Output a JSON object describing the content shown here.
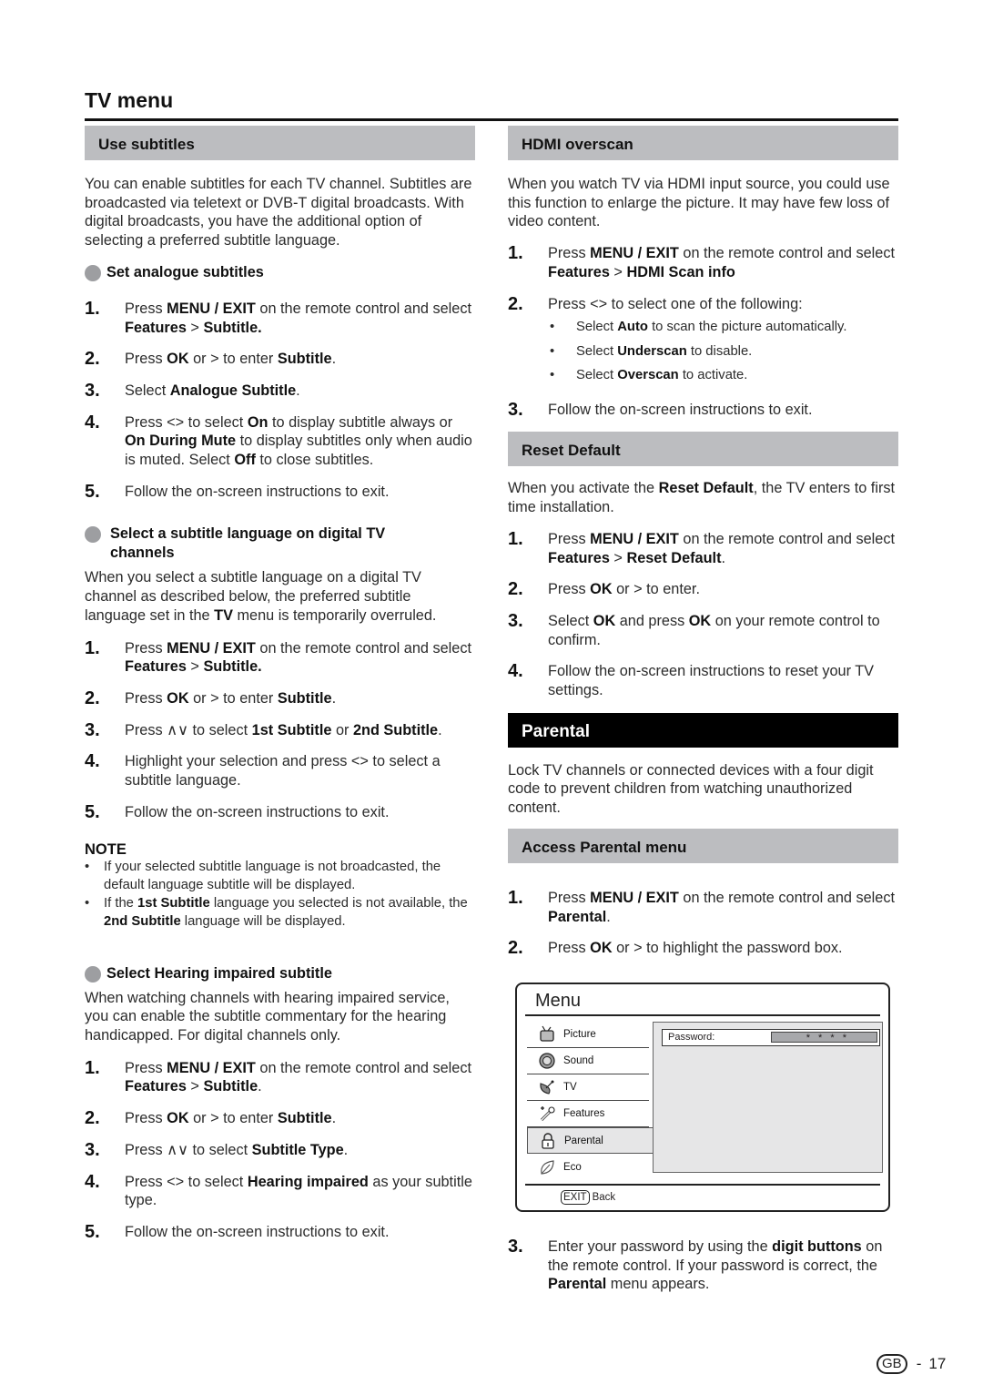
{
  "page": {
    "title": "TV menu",
    "footer": {
      "region_badge": "GB",
      "separator": "-",
      "page_number": "17"
    }
  },
  "left": {
    "use_subtitles": {
      "heading": "Use subtitles",
      "intro": "You can enable subtitles for each TV channel. Subtitles are broadcasted via teletext or DVB-T digital broadcasts. With digital broadcasts, you have the additional option of selecting a preferred subtitle language."
    },
    "analogue": {
      "heading": "Set analogue subtitles",
      "steps": [
        {
          "num": "1.",
          "html": "Press <b>MENU / EXIT</b> on the remote control and select <b>Features</b> &gt; <b>Subtitle.</b>"
        },
        {
          "num": "2.",
          "html": "Press <b>OK</b> or &gt; to enter <b>Subtitle</b>."
        },
        {
          "num": "3.",
          "html": "Select <b>Analogue Subtitle</b>."
        },
        {
          "num": "4.",
          "html": "Press &lt;&gt; to select <b>On</b> to display subtitle always or <b>On During Mute</b> to display subtitles only when audio is muted. Select <b>Off</b> to close subtitles."
        },
        {
          "num": "5.",
          "html": "Follow the on-screen instructions to exit."
        }
      ]
    },
    "digital": {
      "heading": "Select a subtitle language on digital TV channels",
      "intro_html": "When you select a subtitle language on a digital TV channel as described below, the preferred subtitle language set in the <b>TV</b> menu is temporarily overruled.",
      "steps": [
        {
          "num": "1.",
          "html": "Press <b>MENU / EXIT</b> on the remote control and select <b>Features</b> &gt; <b>Subtitle.</b>"
        },
        {
          "num": "2.",
          "html": "Press <b>OK</b> or &gt; to enter <b>Subtitle</b>."
        },
        {
          "num": "3.",
          "html": "Press ∧∨ to select <b>1st Subtitle</b> or <b>2nd Subtitle</b>."
        },
        {
          "num": "4.",
          "html": "Highlight your selection and press &lt;&gt; to select a subtitle language."
        },
        {
          "num": "5.",
          "html": "Follow the on-screen instructions to exit."
        }
      ]
    },
    "note": {
      "title": "NOTE",
      "items": [
        {
          "html": "If your selected subtitle language is not broadcasted, the default language subtitle will be displayed."
        },
        {
          "html": "If the <b>1st Subtitle</b> language you selected is not available, the <b>2nd Subtitle</b> language will be displayed."
        }
      ]
    },
    "hearing": {
      "heading": "Select Hearing impaired subtitle",
      "intro": "When watching channels with hearing impaired service, you can enable the subtitle commentary for the hearing handicapped. For digital channels only.",
      "steps": [
        {
          "num": "1.",
          "html": "Press <b>MENU / EXIT</b> on the remote control and select <b>Features</b> &gt; <b>Subtitle</b>."
        },
        {
          "num": "2.",
          "html": "Press <b>OK</b> or &gt; to enter <b>Subtitle</b>."
        },
        {
          "num": "3.",
          "html": "Press ∧∨ to select <b>Subtitle Type</b>."
        },
        {
          "num": "4.",
          "html": "Press &lt;&gt; to select <b>Hearing impaired</b> as your subtitle type."
        },
        {
          "num": "5.",
          "html": "Follow the on-screen instructions to exit."
        }
      ]
    }
  },
  "right": {
    "hdmi": {
      "heading": "HDMI overscan",
      "intro": "When you watch TV via HDMI input source, you could use this function to enlarge the picture. It may have few loss of video content.",
      "steps": [
        {
          "num": "1.",
          "html": "Press <b>MENU / EXIT</b> on the remote control and select <b>Features</b> &gt; <b>HDMI Scan info</b>"
        },
        {
          "num": "2.",
          "html": "Press &lt;&gt; to select one of the following:"
        },
        {
          "num": "3.",
          "html": "Follow the on-screen instructions to exit."
        }
      ],
      "options": [
        {
          "html": "Select <b>Auto</b> to scan the picture automatically."
        },
        {
          "html": "Select <b>Underscan</b> to disable."
        },
        {
          "html": "Select <b>Overscan</b> to activate."
        }
      ]
    },
    "reset": {
      "heading": "Reset Default",
      "intro_html": "When you activate the <b>Reset Default</b>, the TV enters to first time installation.",
      "steps": [
        {
          "num": "1.",
          "html": "Press <b>MENU / EXIT</b> on the remote control and select <b>Features</b> &gt; <b>Reset Default</b>."
        },
        {
          "num": "2.",
          "html": "Press <b>OK</b> or &gt; to enter."
        },
        {
          "num": "3.",
          "html": "Select <b>OK</b> and press <b>OK</b> on your remote control to confirm."
        },
        {
          "num": "4.",
          "html": "Follow the on-screen instructions to reset your TV settings."
        }
      ]
    },
    "parental": {
      "heading": "Parental",
      "intro": "Lock TV channels or connected devices with a four digit code to prevent children from watching unauthorized content."
    },
    "access": {
      "heading": "Access Parental menu",
      "steps": [
        {
          "num": "1.",
          "html": "Press <b>MENU / EXIT</b> on the remote control and select <b>Parental</b>."
        },
        {
          "num": "2.",
          "html": "Press <b>OK</b> or &gt; to highlight the password box."
        }
      ],
      "steps_after": [
        {
          "num": "3.",
          "html": "Enter your password by using the <b>digit buttons</b> on the remote control. If your password is correct, the <b>Parental</b> menu appears."
        }
      ]
    }
  },
  "tv_menu": {
    "title": "Menu",
    "items": [
      {
        "label": "Picture",
        "icon": "tv-icon"
      },
      {
        "label": "Sound",
        "icon": "speaker-icon"
      },
      {
        "label": "TV",
        "icon": "satellite-dish-icon"
      },
      {
        "label": "Features",
        "icon": "tools-icon"
      },
      {
        "label": "Parental",
        "icon": "lock-icon",
        "selected": true
      },
      {
        "label": "Eco",
        "icon": "leaf-icon"
      }
    ],
    "password_label": "Password:",
    "password_value": "* * * *",
    "exit_key": "EXIT",
    "back_label": "Back"
  },
  "colors": {
    "section_header_bg": "#bcbdc0",
    "section_header_dark_bg": "#000000",
    "bullet_dot": "#9d9ea1",
    "menu_panel_bg": "#e6e6e7",
    "password_box": "#a7a8ab"
  }
}
